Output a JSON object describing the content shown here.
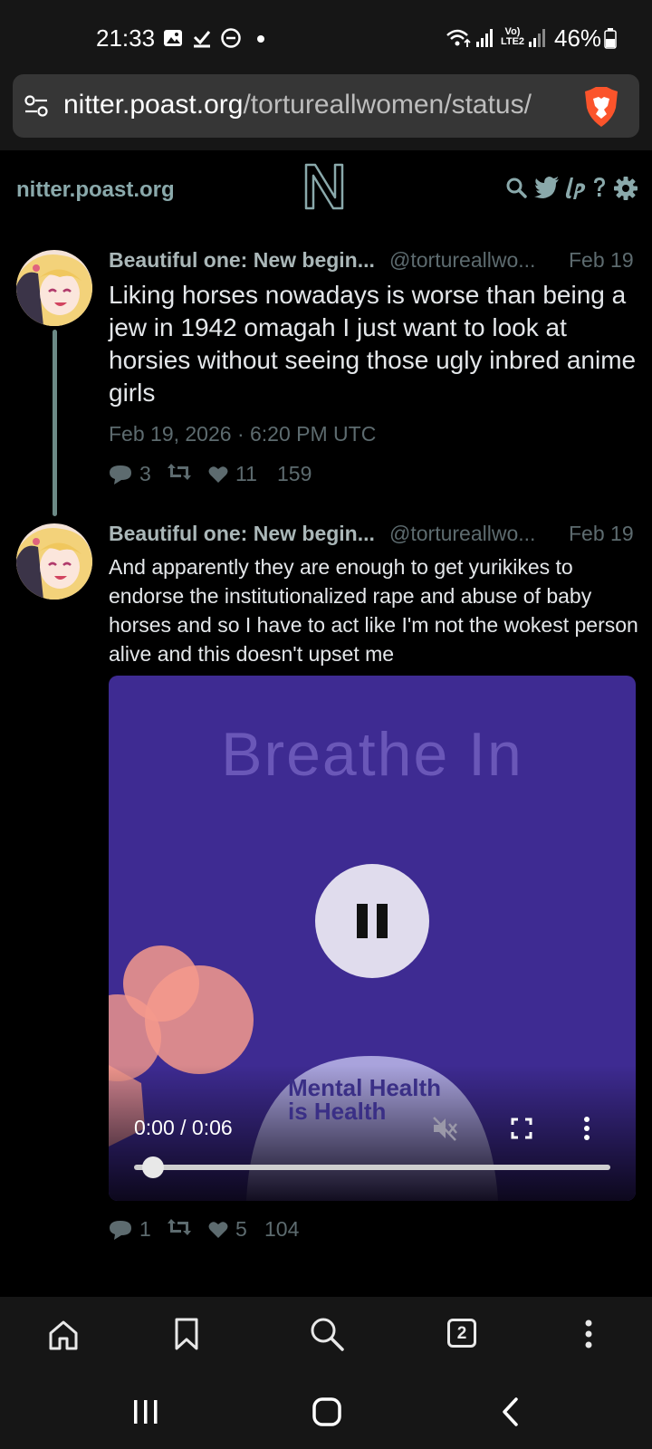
{
  "status_bar": {
    "time": "21:33",
    "network": "Vo) LTE2",
    "battery": "46%"
  },
  "url_bar": {
    "domain": "nitter.poast.org",
    "path": "/tortureallwomen/status/"
  },
  "nav": {
    "site_name": "nitter.poast.org"
  },
  "tweets": [
    {
      "name": "Beautiful one: New begin...",
      "handle": "@tortureallwo...",
      "date": "Feb 19",
      "text": "Liking horses nowadays is worse than being a jew in 1942 omagah I just want to look at horsies without seeing those ugly inbred anime girls",
      "timestamp": "Feb 19, 2026 · 6:20 PM UTC",
      "replies": "3",
      "likes": "11",
      "views": "159"
    },
    {
      "name": "Beautiful one: New begin...",
      "handle": "@tortureallwo...",
      "date": "Feb 19",
      "text": "And apparently they are enough to get yurikikes to endorse the institutionalized rape and abuse of baby horses and so I have to act like I'm not the wokest person alive and this doesn't upset me",
      "replies": "1",
      "likes": "5",
      "views": "104"
    }
  ],
  "video": {
    "title": "Breathe In",
    "brand_line1": "Mental Health",
    "brand_line2": "is Health",
    "time": "0:00 / 0:06",
    "progress": 0.04
  },
  "browser_bar": {
    "tab_count": "2"
  },
  "colors": {
    "accent": "#8aa9ab",
    "video_bg": "#3e2b92",
    "thread_line": "#6c8a86"
  }
}
